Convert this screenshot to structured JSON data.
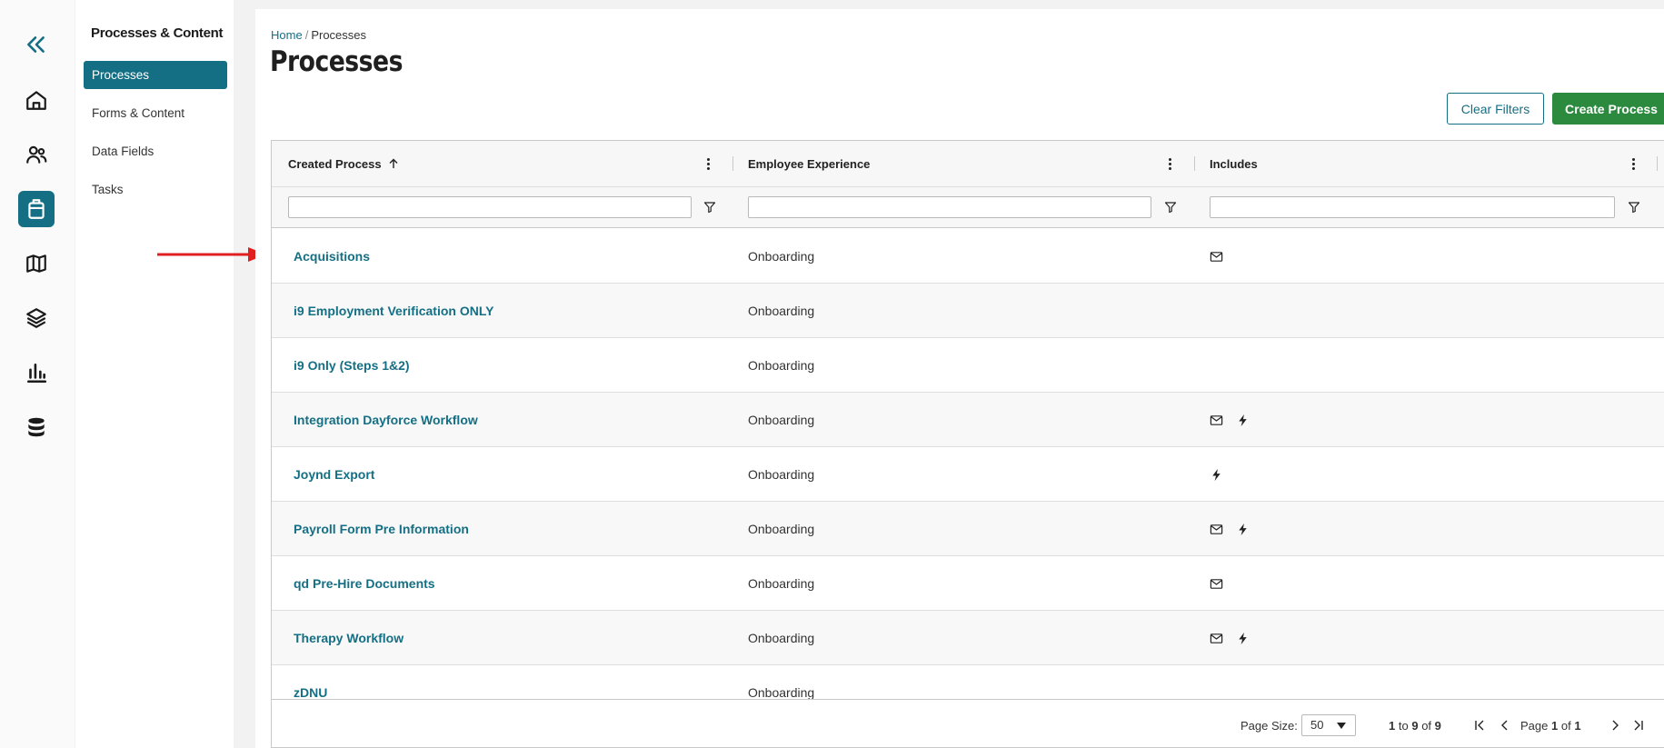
{
  "rail": {
    "items": [
      {
        "icon": "collapse-icon"
      },
      {
        "icon": "home-icon"
      },
      {
        "icon": "people-icon"
      },
      {
        "icon": "processes-icon"
      },
      {
        "icon": "map-icon"
      },
      {
        "icon": "layers-icon"
      },
      {
        "icon": "reports-icon"
      },
      {
        "icon": "database-icon"
      }
    ],
    "active_color": "#156f84"
  },
  "subnav": {
    "title": "Processes & Content",
    "items": [
      {
        "label": "Processes",
        "active": true
      },
      {
        "label": "Forms & Content",
        "active": false
      },
      {
        "label": "Data Fields",
        "active": false
      },
      {
        "label": "Tasks",
        "active": false
      }
    ]
  },
  "breadcrumb": {
    "home": "Home",
    "separator": "/",
    "current": "Processes"
  },
  "page_title": "Processes",
  "actions": {
    "clear_filters": "Clear Filters",
    "create_process": "Create Process"
  },
  "grid": {
    "columns": [
      {
        "label": "Created Process",
        "sort": "ascending"
      },
      {
        "label": "Employee Experience"
      },
      {
        "label": "Includes"
      }
    ],
    "filters": [
      "",
      "",
      ""
    ],
    "rows": [
      {
        "name": "Acquisitions",
        "experience": "Onboarding",
        "includes": [
          "email-icon"
        ]
      },
      {
        "name": "i9 Employment Verification ONLY",
        "experience": "Onboarding",
        "includes": []
      },
      {
        "name": "i9 Only (Steps 1&2)",
        "experience": "Onboarding",
        "includes": []
      },
      {
        "name": "Integration Dayforce Workflow",
        "experience": "Onboarding",
        "includes": [
          "email-icon",
          "lightning-icon"
        ]
      },
      {
        "name": "Joynd Export",
        "experience": "Onboarding",
        "includes": [
          "lightning-icon"
        ]
      },
      {
        "name": "Payroll Form Pre Information",
        "experience": "Onboarding",
        "includes": [
          "email-icon",
          "lightning-icon"
        ]
      },
      {
        "name": "qd Pre-Hire Documents",
        "experience": "Onboarding",
        "includes": [
          "email-icon"
        ]
      },
      {
        "name": "Therapy Workflow",
        "experience": "Onboarding",
        "includes": [
          "email-icon",
          "lightning-icon"
        ]
      },
      {
        "name": "zDNU",
        "experience": "Onboarding",
        "includes": []
      }
    ]
  },
  "pagination": {
    "page_size_label": "Page Size:",
    "page_size": "50",
    "range_from": "1",
    "range_to_word": "to",
    "range_to": "9",
    "of_word": "of",
    "total": "9",
    "page_word": "Page",
    "page": "1",
    "pages": "1"
  },
  "colors": {
    "accent": "#156f84",
    "primary_button": "#2b8a3e",
    "annotation_arrow": "#e02020"
  }
}
